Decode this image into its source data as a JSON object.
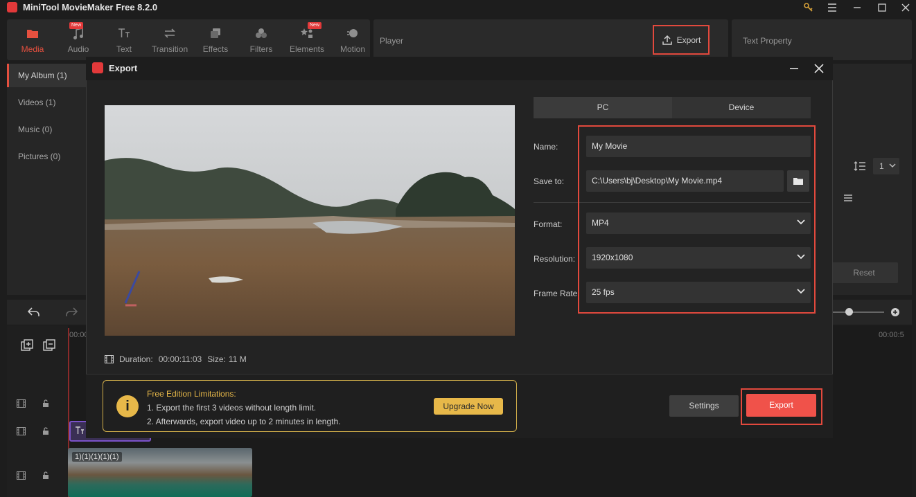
{
  "app": {
    "title": "MiniTool MovieMaker Free 8.2.0"
  },
  "toolbar": {
    "tabs": [
      {
        "label": "Media",
        "icon": "folder-icon",
        "new": false
      },
      {
        "label": "Audio",
        "icon": "music-icon",
        "new": true
      },
      {
        "label": "Text",
        "icon": "text-icon",
        "new": false
      },
      {
        "label": "Transition",
        "icon": "transition-icon",
        "new": false
      },
      {
        "label": "Effects",
        "icon": "effects-icon",
        "new": false
      },
      {
        "label": "Filters",
        "icon": "filters-icon",
        "new": false
      },
      {
        "label": "Elements",
        "icon": "elements-icon",
        "new": true
      },
      {
        "label": "Motion",
        "icon": "motion-icon",
        "new": false
      }
    ],
    "new_badge": "New",
    "accent_color": "#e5503f"
  },
  "player": {
    "label": "Player",
    "export_label": "Export"
  },
  "text_property": {
    "label": "Text Property"
  },
  "sidebar": {
    "items": [
      {
        "label": "My Album (1)"
      },
      {
        "label": "Videos (1)"
      },
      {
        "label": "Music (0)"
      },
      {
        "label": "Pictures (0)"
      }
    ]
  },
  "right_panel": {
    "reset_label": "Reset",
    "speed_value": "1"
  },
  "timeline": {
    "time_start": "00:00",
    "time_end": "00:00:5",
    "clip_label": "1)(1)(1)(1)(1)"
  },
  "dialog": {
    "title": "Export",
    "tabs": [
      {
        "label": "PC"
      },
      {
        "label": "Device"
      }
    ],
    "fields": {
      "name_label": "Name:",
      "name_value": "My Movie",
      "save_label": "Save to:",
      "save_value": "C:\\Users\\bj\\Desktop\\My Movie.mp4",
      "format_label": "Format:",
      "format_value": "MP4",
      "resolution_label": "Resolution:",
      "resolution_value": "1920x1080",
      "framerate_label": "Frame Rate:",
      "framerate_value": "25 fps"
    },
    "duration_label": "Duration:",
    "duration_value": "00:00:11:03",
    "size_label": "Size:",
    "size_value": "11 M",
    "limits": {
      "title": "Free Edition Limitations:",
      "line1": "1. Export the first 3 videos without length limit.",
      "line2": "2. Afterwards, export video up to 2 minutes in length.",
      "upgrade_label": "Upgrade Now"
    },
    "settings_label": "Settings",
    "export_label": "Export",
    "export_color": "#f0524a",
    "highlight_color": "#e2493d"
  }
}
